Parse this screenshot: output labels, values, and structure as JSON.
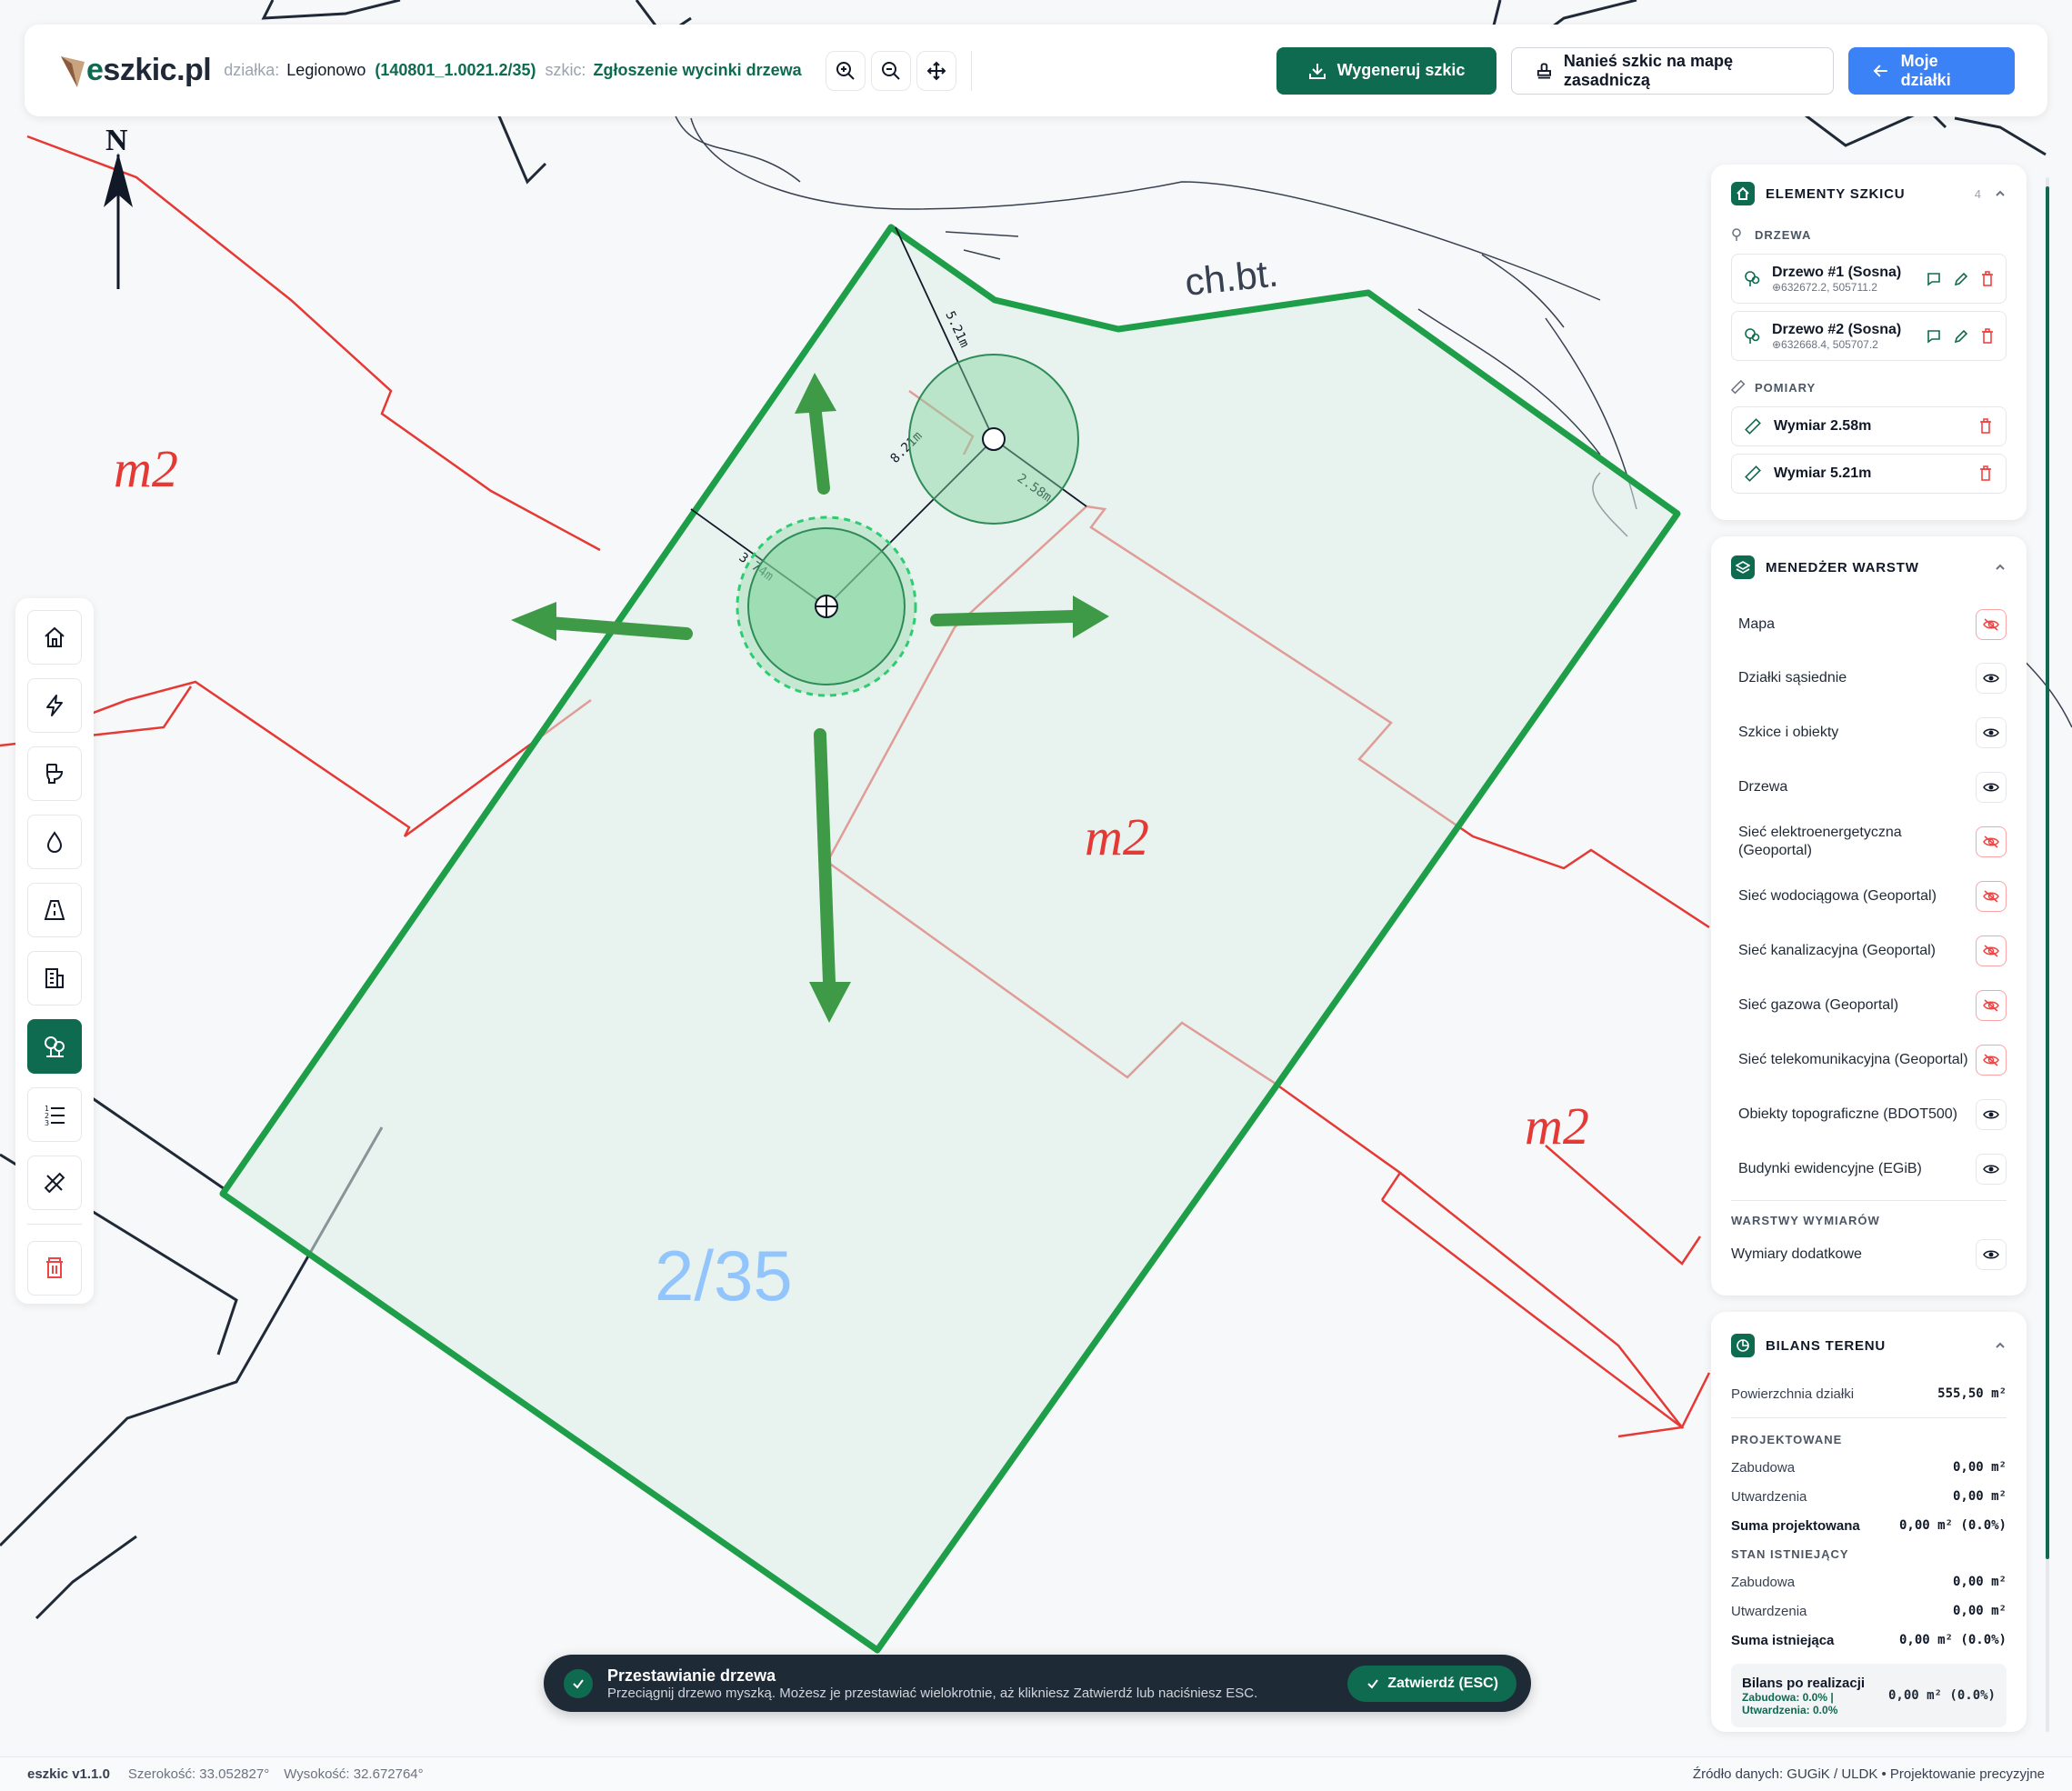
{
  "header": {
    "logo_text_e": "e",
    "logo_text_rest": "szkic.pl",
    "dzialka_label": "działka:",
    "dzialka_city": "Legionowo",
    "dzialka_id": "(140801_1.0021.2/35)",
    "szkic_label": "szkic:",
    "szkic_name": "Zgłoszenie wycinki drzewa",
    "btn_generate": "Wygeneruj szkic",
    "btn_apply_map": "Nanieś szkic na mapę zasadniczą",
    "btn_my_plots": "Moje działki"
  },
  "map": {
    "north_label": "N",
    "labels": [
      "m2",
      "m2",
      "m2",
      "2/35",
      "ch.bt."
    ],
    "dims": [
      "5.21m",
      "8.21m",
      "2.58m",
      "3.74m"
    ]
  },
  "elements": {
    "title": "ELEMENTY SZKICU",
    "count": "4",
    "trees_header": "DRZEWA",
    "trees": [
      {
        "name": "Drzewo #1 (Sosna)",
        "coord": "⊕632672.2, 505711.2"
      },
      {
        "name": "Drzewo #2 (Sosna)",
        "coord": "⊕632668.4, 505707.2"
      }
    ],
    "measures_header": "POMIARY",
    "measures": [
      {
        "name": "Wymiar 2.58m"
      },
      {
        "name": "Wymiar 5.21m"
      }
    ]
  },
  "layers": {
    "title": "MENEDŻER WARSTW",
    "items": [
      {
        "name": "Mapa",
        "visible": false
      },
      {
        "name": "Działki sąsiednie",
        "visible": true
      },
      {
        "name": "Szkice i obiekty",
        "visible": true
      },
      {
        "name": "Drzewa",
        "visible": true
      },
      {
        "name": "Sieć elektroenergetyczna (Geoportal)",
        "visible": false
      },
      {
        "name": "Sieć wodociągowa (Geoportal)",
        "visible": false
      },
      {
        "name": "Sieć kanalizacyjna (Geoportal)",
        "visible": false
      },
      {
        "name": "Sieć gazowa (Geoportal)",
        "visible": false
      },
      {
        "name": "Sieć telekomunikacyjna (Geoportal)",
        "visible": false
      },
      {
        "name": "Obiekty topograficzne (BDOT500)",
        "visible": true
      },
      {
        "name": "Budynki ewidencyjne (EGiB)",
        "visible": true
      }
    ],
    "dim_header": "WARSTWY WYMIARÓW",
    "dim_item": "Wymiary dodatkowe"
  },
  "bilans": {
    "title": "BILANS TERENU",
    "area_label": "Powierzchnia działki",
    "area_value": "555,50 m²",
    "proj_header": "PROJEKTOWANE",
    "proj_zab_label": "Zabudowa",
    "proj_zab_value": "0,00 m²",
    "proj_utw_label": "Utwardzenia",
    "proj_utw_value": "0,00 m²",
    "proj_sum_label": "Suma projektowana",
    "proj_sum_value": "0,00 m² (0.0%)",
    "ex_header": "STAN ISTNIEJĄCY",
    "ex_zab_label": "Zabudowa",
    "ex_zab_value": "0,00 m²",
    "ex_utw_label": "Utwardzenia",
    "ex_utw_value": "0,00 m²",
    "ex_sum_label": "Suma istniejąca",
    "ex_sum_value": "0,00 m² (0.0%)",
    "after_title": "Bilans po realizacji",
    "after_sub1": "Zabudowa: 0.0% |",
    "after_sub2": "Utwardzenia: 0.0%",
    "after_value": "0,00 m² (0.0%)"
  },
  "toast": {
    "title": "Przestawianie drzewa",
    "message": "Przeciągnij drzewo myszką. Możesz je przestawiać wielokrotnie, aż klikniesz Zatwierdź lub naciśniesz ESC.",
    "confirm": "Zatwierdź (ESC)"
  },
  "status": {
    "version": "eszkic v1.1.0",
    "lat": "Szerokość: 33.052827°",
    "lon": "Wysokość: 32.672764°",
    "source": "Źródło danych: GUGiK / ULDK • Projektowanie precyzyjne"
  },
  "colors": {
    "brand_green": "#0f6b4f",
    "plot_green": "#1e9e48",
    "parcel_red": "#e53935",
    "blue": "#3b82f6"
  }
}
